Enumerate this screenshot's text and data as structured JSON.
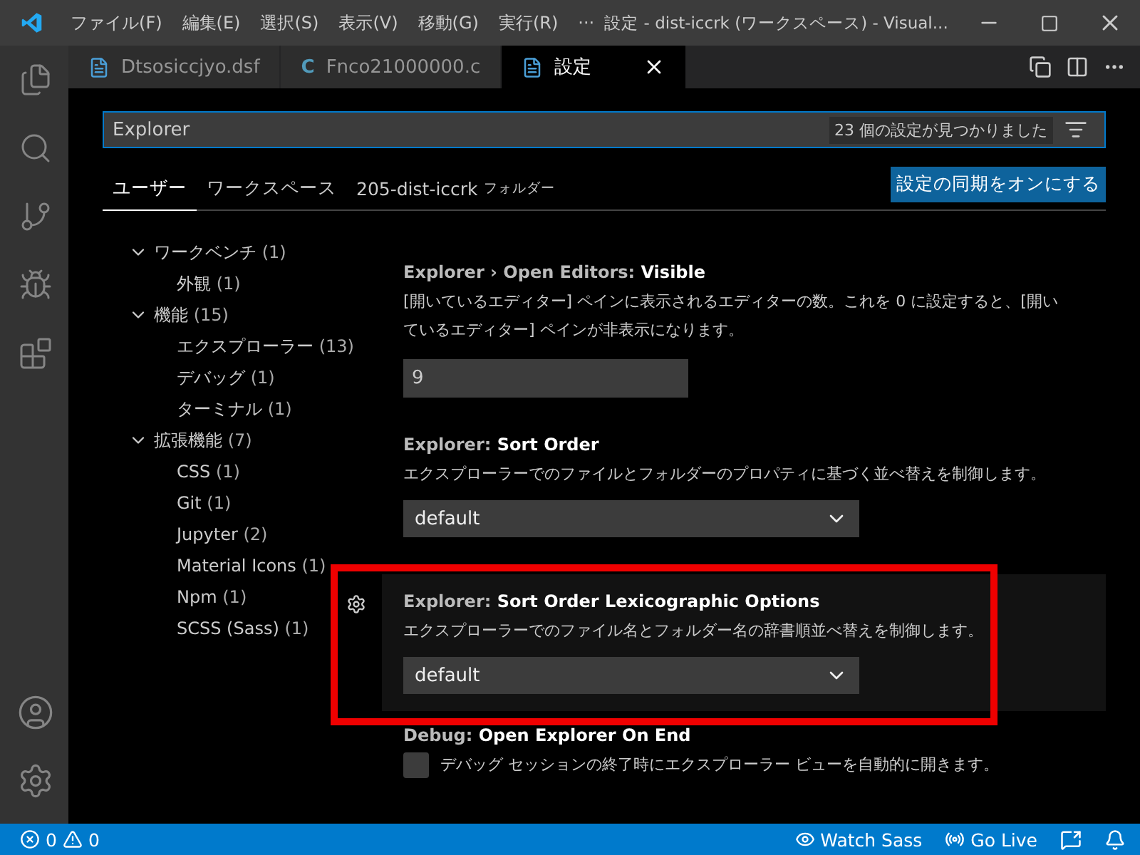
{
  "titlebar": {
    "menus": [
      "ファイル(F)",
      "編集(E)",
      "選択(S)",
      "表示(V)",
      "移動(G)",
      "実行(R)",
      "···"
    ],
    "title": "設定 - dist-iccrk (ワークスペース) - Visual..."
  },
  "activity_bar": [
    {
      "kind": "files",
      "selected": false
    },
    {
      "kind": "search",
      "selected": false
    },
    {
      "kind": "scm",
      "selected": false
    },
    {
      "kind": "debug",
      "selected": false
    },
    {
      "kind": "extensions",
      "selected": false
    }
  ],
  "tabs": [
    {
      "label": "Dtsosiccjyo.dsf",
      "kind": "file",
      "selected": false
    },
    {
      "label": "Fnco21000000.c",
      "kind": "c",
      "icon": "C",
      "selected": false
    },
    {
      "label": "設定",
      "kind": "file",
      "selected": true
    }
  ],
  "search": {
    "value": "Explorer",
    "result_count": "23 個の設定が見つかりました"
  },
  "scopes": [
    {
      "label": "ユーザー",
      "selected": true
    },
    {
      "label": "ワークスペース",
      "selected": false
    },
    {
      "label": "205-dist-iccrk",
      "suffix": "フォルダー",
      "selected": false
    }
  ],
  "sync_button": "設定の同期をオンにする",
  "toc": [
    {
      "name": "ワークベンチ",
      "count": "(1)",
      "expanded": true,
      "children": [
        {
          "name": "外観",
          "count": "(1)"
        }
      ]
    },
    {
      "name": "機能",
      "count": "(15)",
      "expanded": true,
      "children": [
        {
          "name": "エクスプローラー",
          "count": "(13)"
        },
        {
          "name": "デバッグ",
          "count": "(1)"
        },
        {
          "name": "ターミナル",
          "count": "(1)"
        }
      ]
    },
    {
      "name": "拡張機能",
      "count": "(7)",
      "expanded": true,
      "children": [
        {
          "name": "CSS",
          "count": "(1)"
        },
        {
          "name": "Git",
          "count": "(1)"
        },
        {
          "name": "Jupyter",
          "count": "(2)"
        },
        {
          "name": "Material Icons",
          "count": "(1)"
        },
        {
          "name": "Npm",
          "count": "(1)"
        },
        {
          "name": "SCSS (Sass)",
          "count": "(1)"
        }
      ]
    }
  ],
  "settings": [
    {
      "category": "Explorer › Open Editors: ",
      "name": "Visible",
      "description": "[開いているエディター] ペインに表示されるエディターの数。これを 0 に設定すると、[開いているエディター] ペインが非表示になります。",
      "kind": "number",
      "value": "9",
      "focused": false
    },
    {
      "category": "Explorer: ",
      "name": "Sort Order",
      "description": "エクスプローラーでのファイルとフォルダーのプロパティに基づく並べ替えを制御します。",
      "kind": "select",
      "value": "default",
      "focused": false
    },
    {
      "category": "Explorer: ",
      "name": "Sort Order Lexicographic Options",
      "description": "エクスプローラーでのファイル名とフォルダー名の辞書順並べ替えを制御します。",
      "kind": "select",
      "value": "default",
      "focused": true
    },
    {
      "category": "Debug: ",
      "name": "Open Explorer On End",
      "description": "デバッグ セッションの終了時にエクスプローラー ビューを自動的に開きます。",
      "kind": "checkbox",
      "checked": false,
      "focused": false
    }
  ],
  "status_bar": {
    "errors": "0",
    "warnings": "0",
    "right": [
      {
        "kind": "eye",
        "label": "Watch Sass"
      },
      {
        "kind": "broadcast",
        "label": "Go Live"
      }
    ]
  }
}
